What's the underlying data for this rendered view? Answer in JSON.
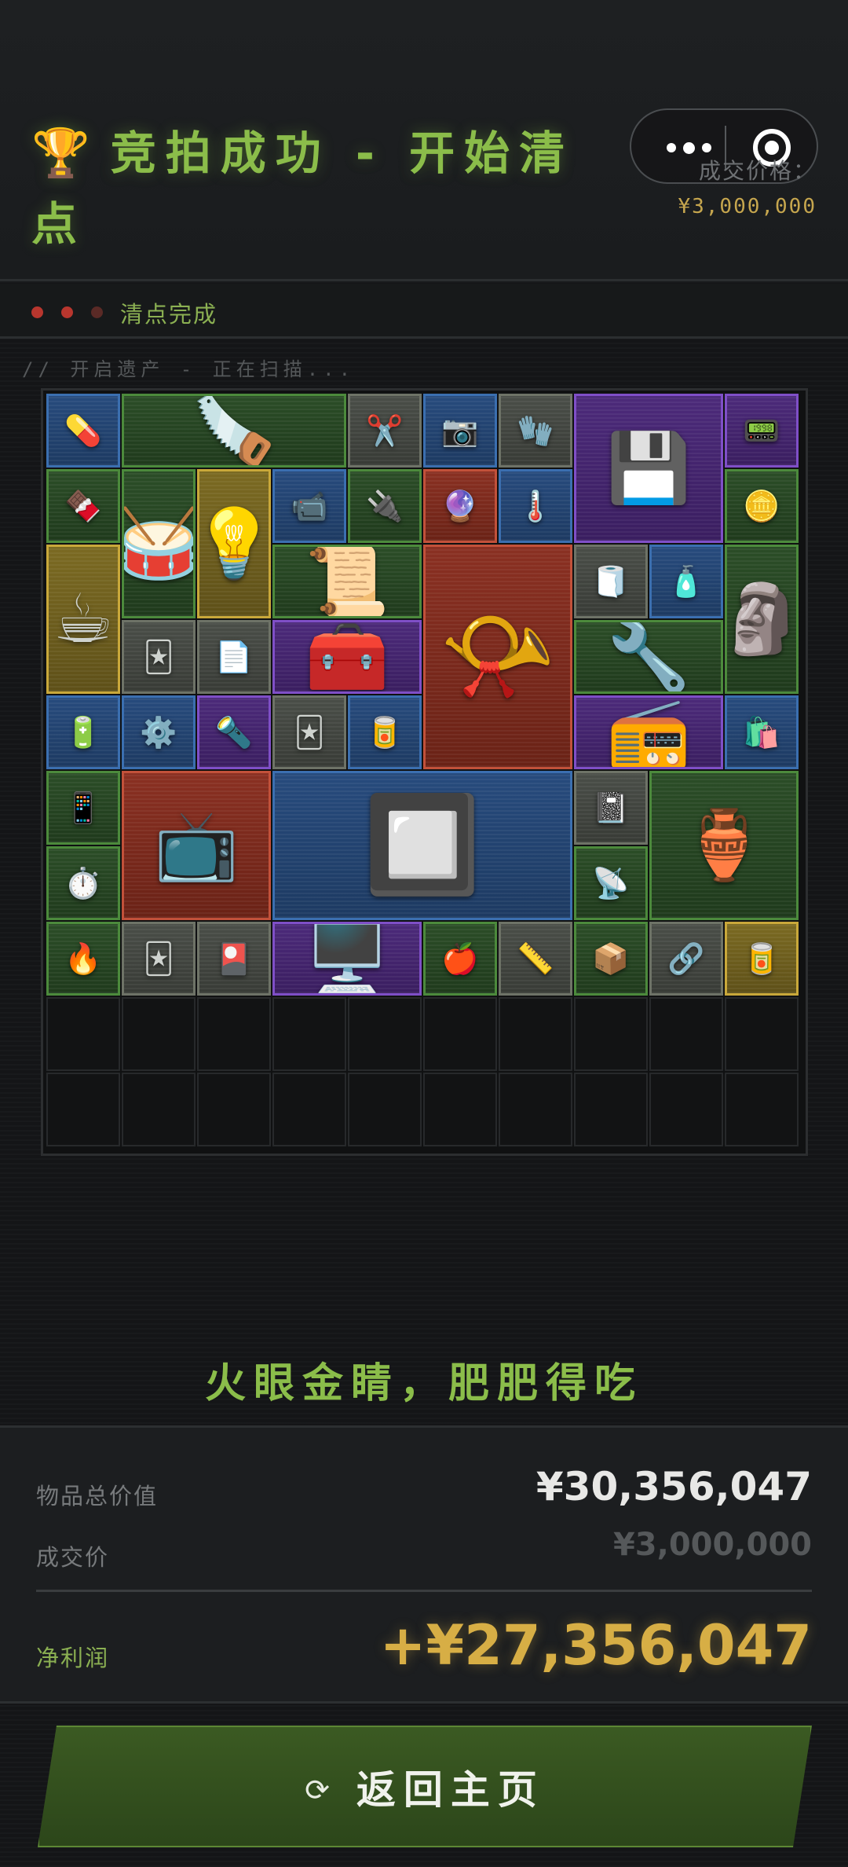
{
  "header": {
    "trophy_icon": "🏆",
    "title": "竞拍成功 - 开始清点",
    "price_label": "成交价格：",
    "price_value": "¥3,000,000"
  },
  "capsule": {
    "more_icon": "more-dots-icon",
    "close_icon": "target-icon"
  },
  "status": {
    "text": "清点完成"
  },
  "scan_text": "// 开启遗产 - 正在扫描...",
  "grid": {
    "cols": 10,
    "rows": 10
  },
  "items": [
    {
      "name": "pills-bottle",
      "icon": "💊",
      "rarity": "blue",
      "c": 0,
      "r": 0,
      "w": 1,
      "h": 1
    },
    {
      "name": "hacksaw",
      "icon": "🪚",
      "rarity": "green",
      "c": 1,
      "r": 0,
      "w": 3,
      "h": 1
    },
    {
      "name": "scissors",
      "icon": "✂️",
      "rarity": "gray",
      "c": 4,
      "r": 0,
      "w": 1,
      "h": 1
    },
    {
      "name": "action-camera",
      "icon": "📷",
      "rarity": "blue",
      "c": 5,
      "r": 0,
      "w": 1,
      "h": 1
    },
    {
      "name": "gloves",
      "icon": "🧤",
      "rarity": "gray",
      "c": 6,
      "r": 0,
      "w": 1,
      "h": 1
    },
    {
      "name": "hard-drive",
      "icon": "💾",
      "rarity": "purple",
      "c": 7,
      "r": 0,
      "w": 2,
      "h": 2
    },
    {
      "name": "radio-module",
      "icon": "📟",
      "rarity": "purple",
      "c": 9,
      "r": 0,
      "w": 1,
      "h": 1
    },
    {
      "name": "snack-bar",
      "icon": "🍫",
      "rarity": "green",
      "c": 0,
      "r": 1,
      "w": 1,
      "h": 1
    },
    {
      "name": "djembe-drum",
      "icon": "🥁",
      "rarity": "green",
      "c": 1,
      "r": 1,
      "w": 1,
      "h": 2
    },
    {
      "name": "lamp-tube",
      "icon": "💡",
      "rarity": "gold",
      "c": 2,
      "r": 1,
      "w": 1,
      "h": 2
    },
    {
      "name": "webcam",
      "icon": "📹",
      "rarity": "blue",
      "c": 3,
      "r": 1,
      "w": 1,
      "h": 1
    },
    {
      "name": "circuit-board",
      "icon": "🔌",
      "rarity": "green",
      "c": 4,
      "r": 1,
      "w": 1,
      "h": 1
    },
    {
      "name": "glass-orb",
      "icon": "🔮",
      "rarity": "red",
      "c": 5,
      "r": 1,
      "w": 1,
      "h": 1
    },
    {
      "name": "thermometer-gun",
      "icon": "🌡️",
      "rarity": "blue",
      "c": 6,
      "r": 1,
      "w": 1,
      "h": 1
    },
    {
      "name": "gold-coin",
      "icon": "🪙",
      "rarity": "green",
      "c": 9,
      "r": 1,
      "w": 1,
      "h": 1
    },
    {
      "name": "coffee-box",
      "icon": "☕",
      "rarity": "gold",
      "c": 0,
      "r": 2,
      "w": 1,
      "h": 2
    },
    {
      "name": "old-letter",
      "icon": "📜",
      "rarity": "green",
      "c": 3,
      "r": 2,
      "w": 2,
      "h": 1
    },
    {
      "name": "gramophone",
      "icon": "📯",
      "rarity": "red",
      "c": 5,
      "r": 2,
      "w": 2,
      "h": 3
    },
    {
      "name": "tape-roll",
      "icon": "🧻",
      "rarity": "gray",
      "c": 7,
      "r": 2,
      "w": 1,
      "h": 1
    },
    {
      "name": "water-bottle",
      "icon": "🧴",
      "rarity": "blue",
      "c": 8,
      "r": 2,
      "w": 1,
      "h": 1
    },
    {
      "name": "tribal-statue",
      "icon": "🗿",
      "rarity": "green",
      "c": 9,
      "r": 2,
      "w": 1,
      "h": 2
    },
    {
      "name": "playing-card-hearts",
      "icon": "🃏",
      "rarity": "gray",
      "c": 1,
      "r": 3,
      "w": 1,
      "h": 1
    },
    {
      "name": "paper-note",
      "icon": "📄",
      "rarity": "gray",
      "c": 2,
      "r": 3,
      "w": 1,
      "h": 1
    },
    {
      "name": "edc-kit",
      "icon": "🧰",
      "rarity": "purple",
      "c": 3,
      "r": 3,
      "w": 2,
      "h": 1
    },
    {
      "name": "cordless-drill",
      "icon": "🔧",
      "rarity": "green",
      "c": 7,
      "r": 3,
      "w": 2,
      "h": 1
    },
    {
      "name": "battery-pack",
      "icon": "🔋",
      "rarity": "blue",
      "c": 0,
      "r": 4,
      "w": 1,
      "h": 1
    },
    {
      "name": "mechanical-part",
      "icon": "⚙️",
      "rarity": "blue",
      "c": 1,
      "r": 4,
      "w": 1,
      "h": 1
    },
    {
      "name": "flashlight",
      "icon": "🔦",
      "rarity": "purple",
      "c": 2,
      "r": 4,
      "w": 1,
      "h": 1
    },
    {
      "name": "playing-card",
      "icon": "🃏",
      "rarity": "gray",
      "c": 3,
      "r": 4,
      "w": 1,
      "h": 1
    },
    {
      "name": "cola-can",
      "icon": "🥫",
      "rarity": "blue",
      "c": 4,
      "r": 4,
      "w": 1,
      "h": 1
    },
    {
      "name": "boombox",
      "icon": "📻",
      "rarity": "purple",
      "c": 7,
      "r": 4,
      "w": 2,
      "h": 1
    },
    {
      "name": "snack-bag",
      "icon": "🛍️",
      "rarity": "blue",
      "c": 9,
      "r": 4,
      "w": 1,
      "h": 1
    },
    {
      "name": "smart-phone",
      "icon": "📱",
      "rarity": "green",
      "c": 0,
      "r": 5,
      "w": 1,
      "h": 1
    },
    {
      "name": "field-monitor",
      "icon": "📺",
      "rarity": "red",
      "c": 1,
      "r": 5,
      "w": 2,
      "h": 2
    },
    {
      "name": "solar-panel",
      "icon": "🔲",
      "rarity": "blue",
      "c": 3,
      "r": 5,
      "w": 4,
      "h": 2
    },
    {
      "name": "notebook",
      "icon": "📓",
      "rarity": "gray",
      "c": 7,
      "r": 5,
      "w": 1,
      "h": 1
    },
    {
      "name": "tagine-pot",
      "icon": "🏺",
      "rarity": "green",
      "c": 8,
      "r": 5,
      "w": 2,
      "h": 2
    },
    {
      "name": "pressure-gauge",
      "icon": "⏱️",
      "rarity": "green",
      "c": 0,
      "r": 6,
      "w": 1,
      "h": 1
    },
    {
      "name": "gps-device",
      "icon": "📡",
      "rarity": "green",
      "c": 7,
      "r": 6,
      "w": 1,
      "h": 1
    },
    {
      "name": "lighter",
      "icon": "🔥",
      "rarity": "green",
      "c": 0,
      "r": 7,
      "w": 1,
      "h": 1
    },
    {
      "name": "playing-card-clubs",
      "icon": "🃏",
      "rarity": "gray",
      "c": 1,
      "r": 7,
      "w": 1,
      "h": 1
    },
    {
      "name": "card-pack",
      "icon": "🎴",
      "rarity": "gray",
      "c": 2,
      "r": 7,
      "w": 1,
      "h": 1
    },
    {
      "name": "graphics-card",
      "icon": "🖥️",
      "rarity": "purple",
      "c": 3,
      "r": 7,
      "w": 2,
      "h": 1
    },
    {
      "name": "red-apple",
      "icon": "🍎",
      "rarity": "green",
      "c": 5,
      "r": 7,
      "w": 1,
      "h": 1
    },
    {
      "name": "tape-measure",
      "icon": "📏",
      "rarity": "gray",
      "c": 6,
      "r": 7,
      "w": 1,
      "h": 1
    },
    {
      "name": "sensor-device",
      "icon": "📦",
      "rarity": "green",
      "c": 7,
      "r": 7,
      "w": 1,
      "h": 1
    },
    {
      "name": "usb-cable",
      "icon": "🔗",
      "rarity": "gray",
      "c": 8,
      "r": 7,
      "w": 1,
      "h": 1
    },
    {
      "name": "tin-box",
      "icon": "🥫",
      "rarity": "gold",
      "c": 9,
      "r": 7,
      "w": 1,
      "h": 1
    }
  ],
  "slogan": "火眼金睛，肥肥得吃",
  "summary": {
    "total_label": "物品总价值",
    "total_value": "¥30,356,047",
    "deal_label": "成交价",
    "deal_value": "¥3,000,000",
    "profit_label": "净利润",
    "profit_value": "+¥27,356,047"
  },
  "button": {
    "icon": "⟳",
    "label": "返回主页"
  }
}
